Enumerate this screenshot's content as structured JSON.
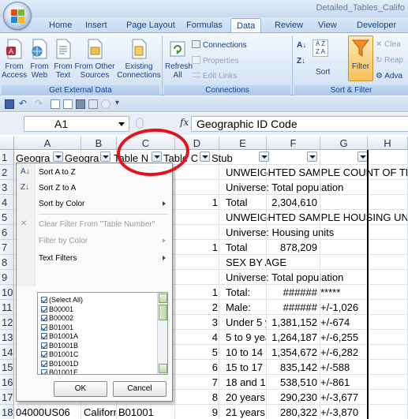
{
  "window": {
    "title": "Detailed_Tables_Califo"
  },
  "ribbon_tabs": [
    "Home",
    "Insert",
    "Page Layout",
    "Formulas",
    "Data",
    "Review",
    "View",
    "Developer"
  ],
  "active_tab": "Data",
  "ribbon": {
    "get_external_data": {
      "label": "Get External Data",
      "from_access": "From Access",
      "from_web": "From Web",
      "from_text": "From Text",
      "from_other": "From Other Sources",
      "existing": "Existing Connections"
    },
    "connections": {
      "label": "Connections",
      "refresh": "Refresh All",
      "connections": "Connections",
      "properties": "Properties",
      "edit_links": "Edit Links"
    },
    "sort_filter": {
      "label": "Sort & Filter",
      "sort": "Sort",
      "filter": "Filter",
      "clear": "Clea",
      "reapply": "Reap",
      "advanced": "Adva"
    }
  },
  "formula_bar": {
    "name_box": "A1",
    "fx": "fx",
    "content": "Geographic ID Code"
  },
  "columns": [
    "A",
    "B",
    "C",
    "D",
    "E",
    "F",
    "G",
    "H"
  ],
  "header_row": {
    "A": "Geogra",
    "B": "Geogra",
    "C": "Table N",
    "D": "Table C",
    "E": "Stub"
  },
  "rows": [
    {
      "num": "1"
    },
    {
      "num": "2",
      "d": "",
      "e": "UNWEIGHTED SAMPLE COUNT OF THE P"
    },
    {
      "num": "3",
      "e": "Universe: Total population"
    },
    {
      "num": "4",
      "d": "1",
      "e": "Total",
      "f": "2,304,610"
    },
    {
      "num": "5",
      "e": "UNWEIGHTED SAMPLE HOUSING UNITS"
    },
    {
      "num": "6",
      "e": "Universe: Housing units"
    },
    {
      "num": "7",
      "d": "1",
      "e": "Total",
      "f": "878,209"
    },
    {
      "num": "8",
      "e": "SEX BY AGE"
    },
    {
      "num": "9",
      "e": "Universe: Total population"
    },
    {
      "num": "10",
      "d": "1",
      "e": "Total:",
      "f": "######",
      "g": "*****"
    },
    {
      "num": "11",
      "d": "2",
      "e": "Male:",
      "f": "######",
      "g": "+/-1,026"
    },
    {
      "num": "12",
      "d": "3",
      "e": "Under 5 y",
      "f": "1,381,152",
      "g": "+/-674"
    },
    {
      "num": "13",
      "d": "4",
      "e": "5 to 9 yea",
      "f": "1,264,187",
      "g": "+/-6,255"
    },
    {
      "num": "14",
      "d": "5",
      "e": "10 to 14 ye",
      "f": "1,354,672",
      "g": "+/-6,282"
    },
    {
      "num": "15",
      "d": "6",
      "e": "15 to 17 ye",
      "f": "835,142",
      "g": "+/-588"
    },
    {
      "num": "16",
      "d": "7",
      "e": "18 and 19",
      "f": "538,510",
      "g": "+/-861"
    },
    {
      "num": "17",
      "d": "8",
      "e": "20 years",
      "f": "290,230",
      "g": "+/-3,677"
    },
    {
      "num": "18",
      "a": "04000US06",
      "b": "California",
      "c": "B01001",
      "d": "9",
      "e": "21 years",
      "f": "280,322",
      "g": "+/-3,870"
    }
  ],
  "filter_menu": {
    "sort_az": "Sort A to Z",
    "sort_za": "Sort Z to A",
    "sort_color": "Sort by Color",
    "clear_filter": "Clear Filter From \"Table Number\"",
    "filter_color": "Filter by Color",
    "text_filters": "Text Filters",
    "items": [
      "(Select All)",
      "B00001",
      "B00002",
      "B01001",
      "B01001A",
      "B01001B",
      "B01001C",
      "B01001D",
      "B01001E",
      "B01001F",
      "B01001G"
    ],
    "ok": "OK",
    "cancel": "Cancel"
  }
}
